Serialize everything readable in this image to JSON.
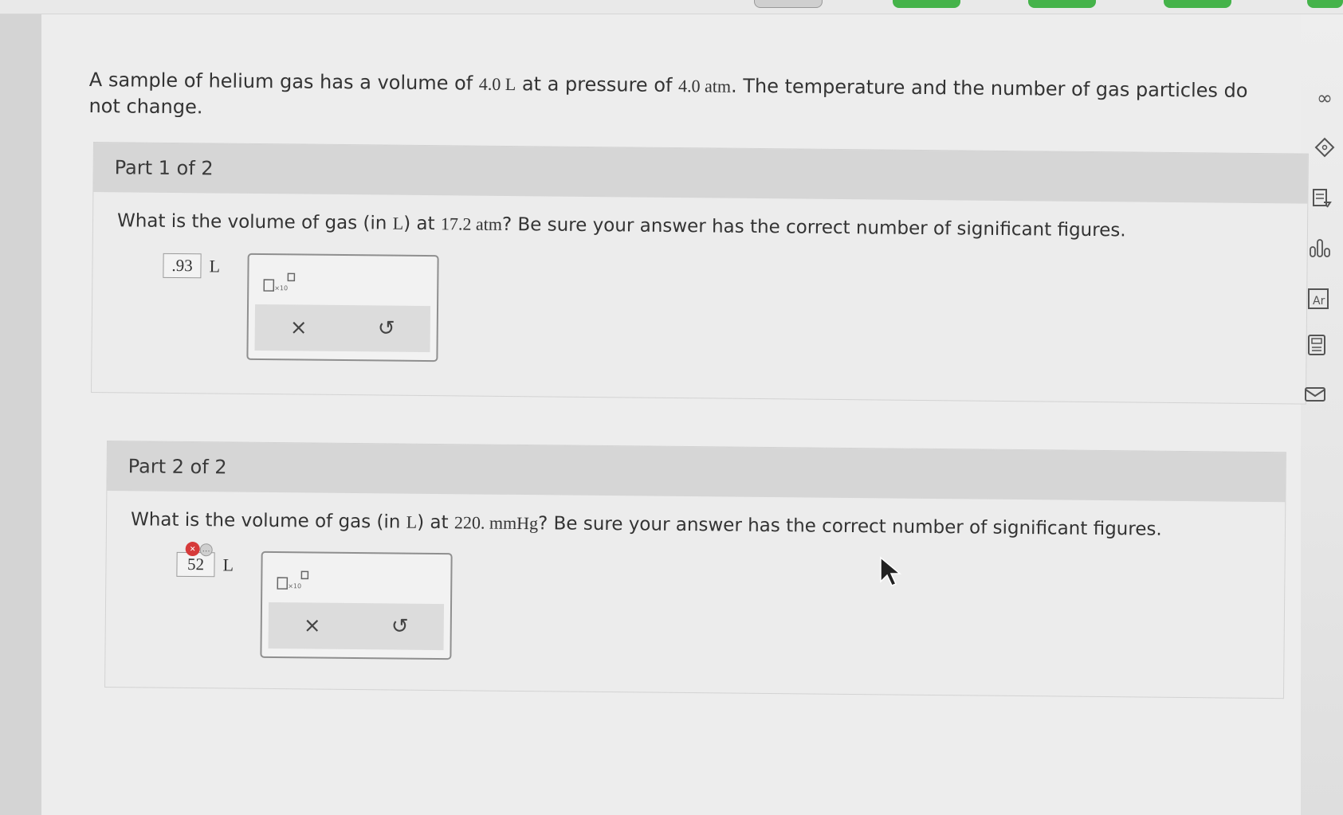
{
  "problem": {
    "intro_part1": "A sample of helium gas has a volume of ",
    "volume": "4.0 L",
    "intro_part2": " at a pressure of ",
    "pressure": "4.0 atm",
    "intro_part3": ". The temperature and the number of gas particles do not change."
  },
  "parts": [
    {
      "header": "Part 1 of 2",
      "q_part1": "What is the volume of gas (in ",
      "q_unit": "L",
      "q_part2": ") at ",
      "q_value": "17.2 atm",
      "q_part3": "? Be sure your answer has the correct number of significant figures.",
      "answer_value": ".93",
      "answer_unit": "L",
      "clear_label": "×",
      "undo_label": "↺"
    },
    {
      "header": "Part 2 of 2",
      "q_part1": "What is the volume of gas (in ",
      "q_unit": "L",
      "q_part2": ") at ",
      "q_value": "220. mmHg",
      "q_part3": "? Be sure your answer has the correct number of significant figures.",
      "answer_value": "52",
      "answer_unit": "L",
      "error_badge": "×",
      "info_badge": "…",
      "clear_label": "×",
      "undo_label": "↺"
    }
  ],
  "sidebar": {
    "icons": [
      "infinity-icon",
      "tag-icon",
      "notes-icon",
      "chart-icon",
      "periodic-table-icon",
      "calculator-icon",
      "mail-icon"
    ],
    "infinity_glyph": "∞"
  }
}
